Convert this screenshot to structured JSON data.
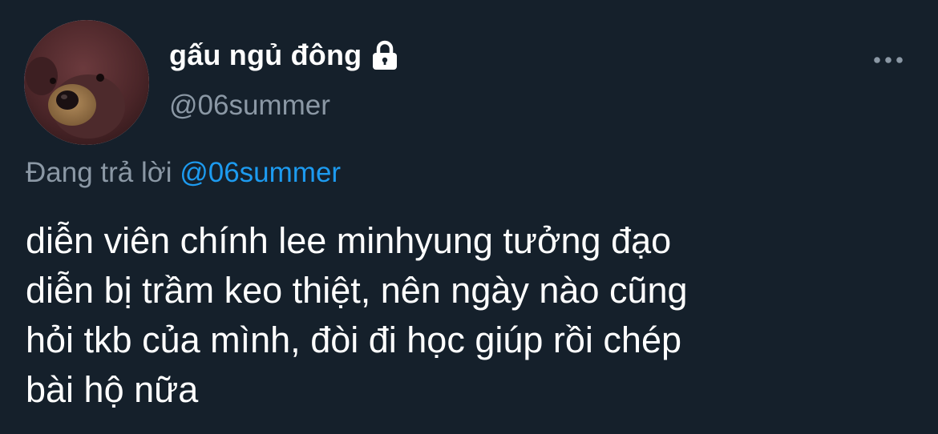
{
  "colors": {
    "background": "#15202b",
    "primary_text": "#ffffff",
    "secondary_text": "#8b98a5",
    "accent": "#1d9bf0"
  },
  "author": {
    "display_name": "gấu ngủ đông",
    "handle": "@06summer",
    "protected_icon": "lock-icon",
    "avatar_icon": "teddy-bear-avatar"
  },
  "menu": {
    "icon": "more-options-icon"
  },
  "reply": {
    "label": "Đang trả lời",
    "mention": "@06summer"
  },
  "tweet": {
    "lines": [
      "diễn viên chính lee minhyung tưởng đạo",
      "diễn bị trầm keo thiệt, nên ngày nào cũng",
      "hỏi tkb của mình, đòi đi học giúp rồi chép",
      "bài hộ nữa"
    ]
  }
}
